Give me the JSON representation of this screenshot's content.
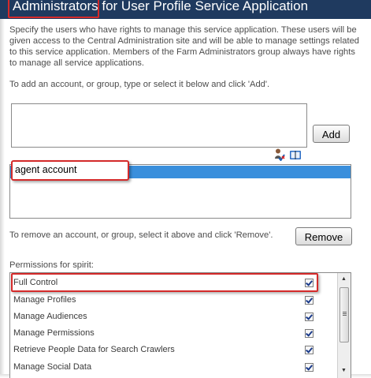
{
  "dialog": {
    "title": "Administrators for User Profile Service Application",
    "description": "Specify the users who have rights to manage this service application. These users will be given access to the Central Administration site and will be able to manage settings related to this service application. Members of the Farm Administrators group always have rights to manage all service applications.",
    "add_instruction": "To add an account, or group, type or select it below and click 'Add'.",
    "people_input_value": "",
    "add_button": "Add",
    "icons": {
      "check_names": "check-names-icon",
      "browse": "address-book-icon"
    },
    "selected_account": "agent account",
    "remove_instruction": "To remove an account, or group, select it above and click 'Remove'.",
    "remove_button": "Remove",
    "permissions_label": "Permissions for spirit:",
    "permissions": [
      {
        "label": "Full Control",
        "checked": true
      },
      {
        "label": "Manage Profiles",
        "checked": true
      },
      {
        "label": "Manage Audiences",
        "checked": true
      },
      {
        "label": "Manage Permissions",
        "checked": true
      },
      {
        "label": "Retrieve People Data for Search Crawlers",
        "checked": true
      },
      {
        "label": "Manage Social Data",
        "checked": true
      }
    ],
    "colors": {
      "title_bar": "#1f3a5f",
      "selection": "#3a8fdc",
      "highlight": "#d42a2a"
    }
  }
}
